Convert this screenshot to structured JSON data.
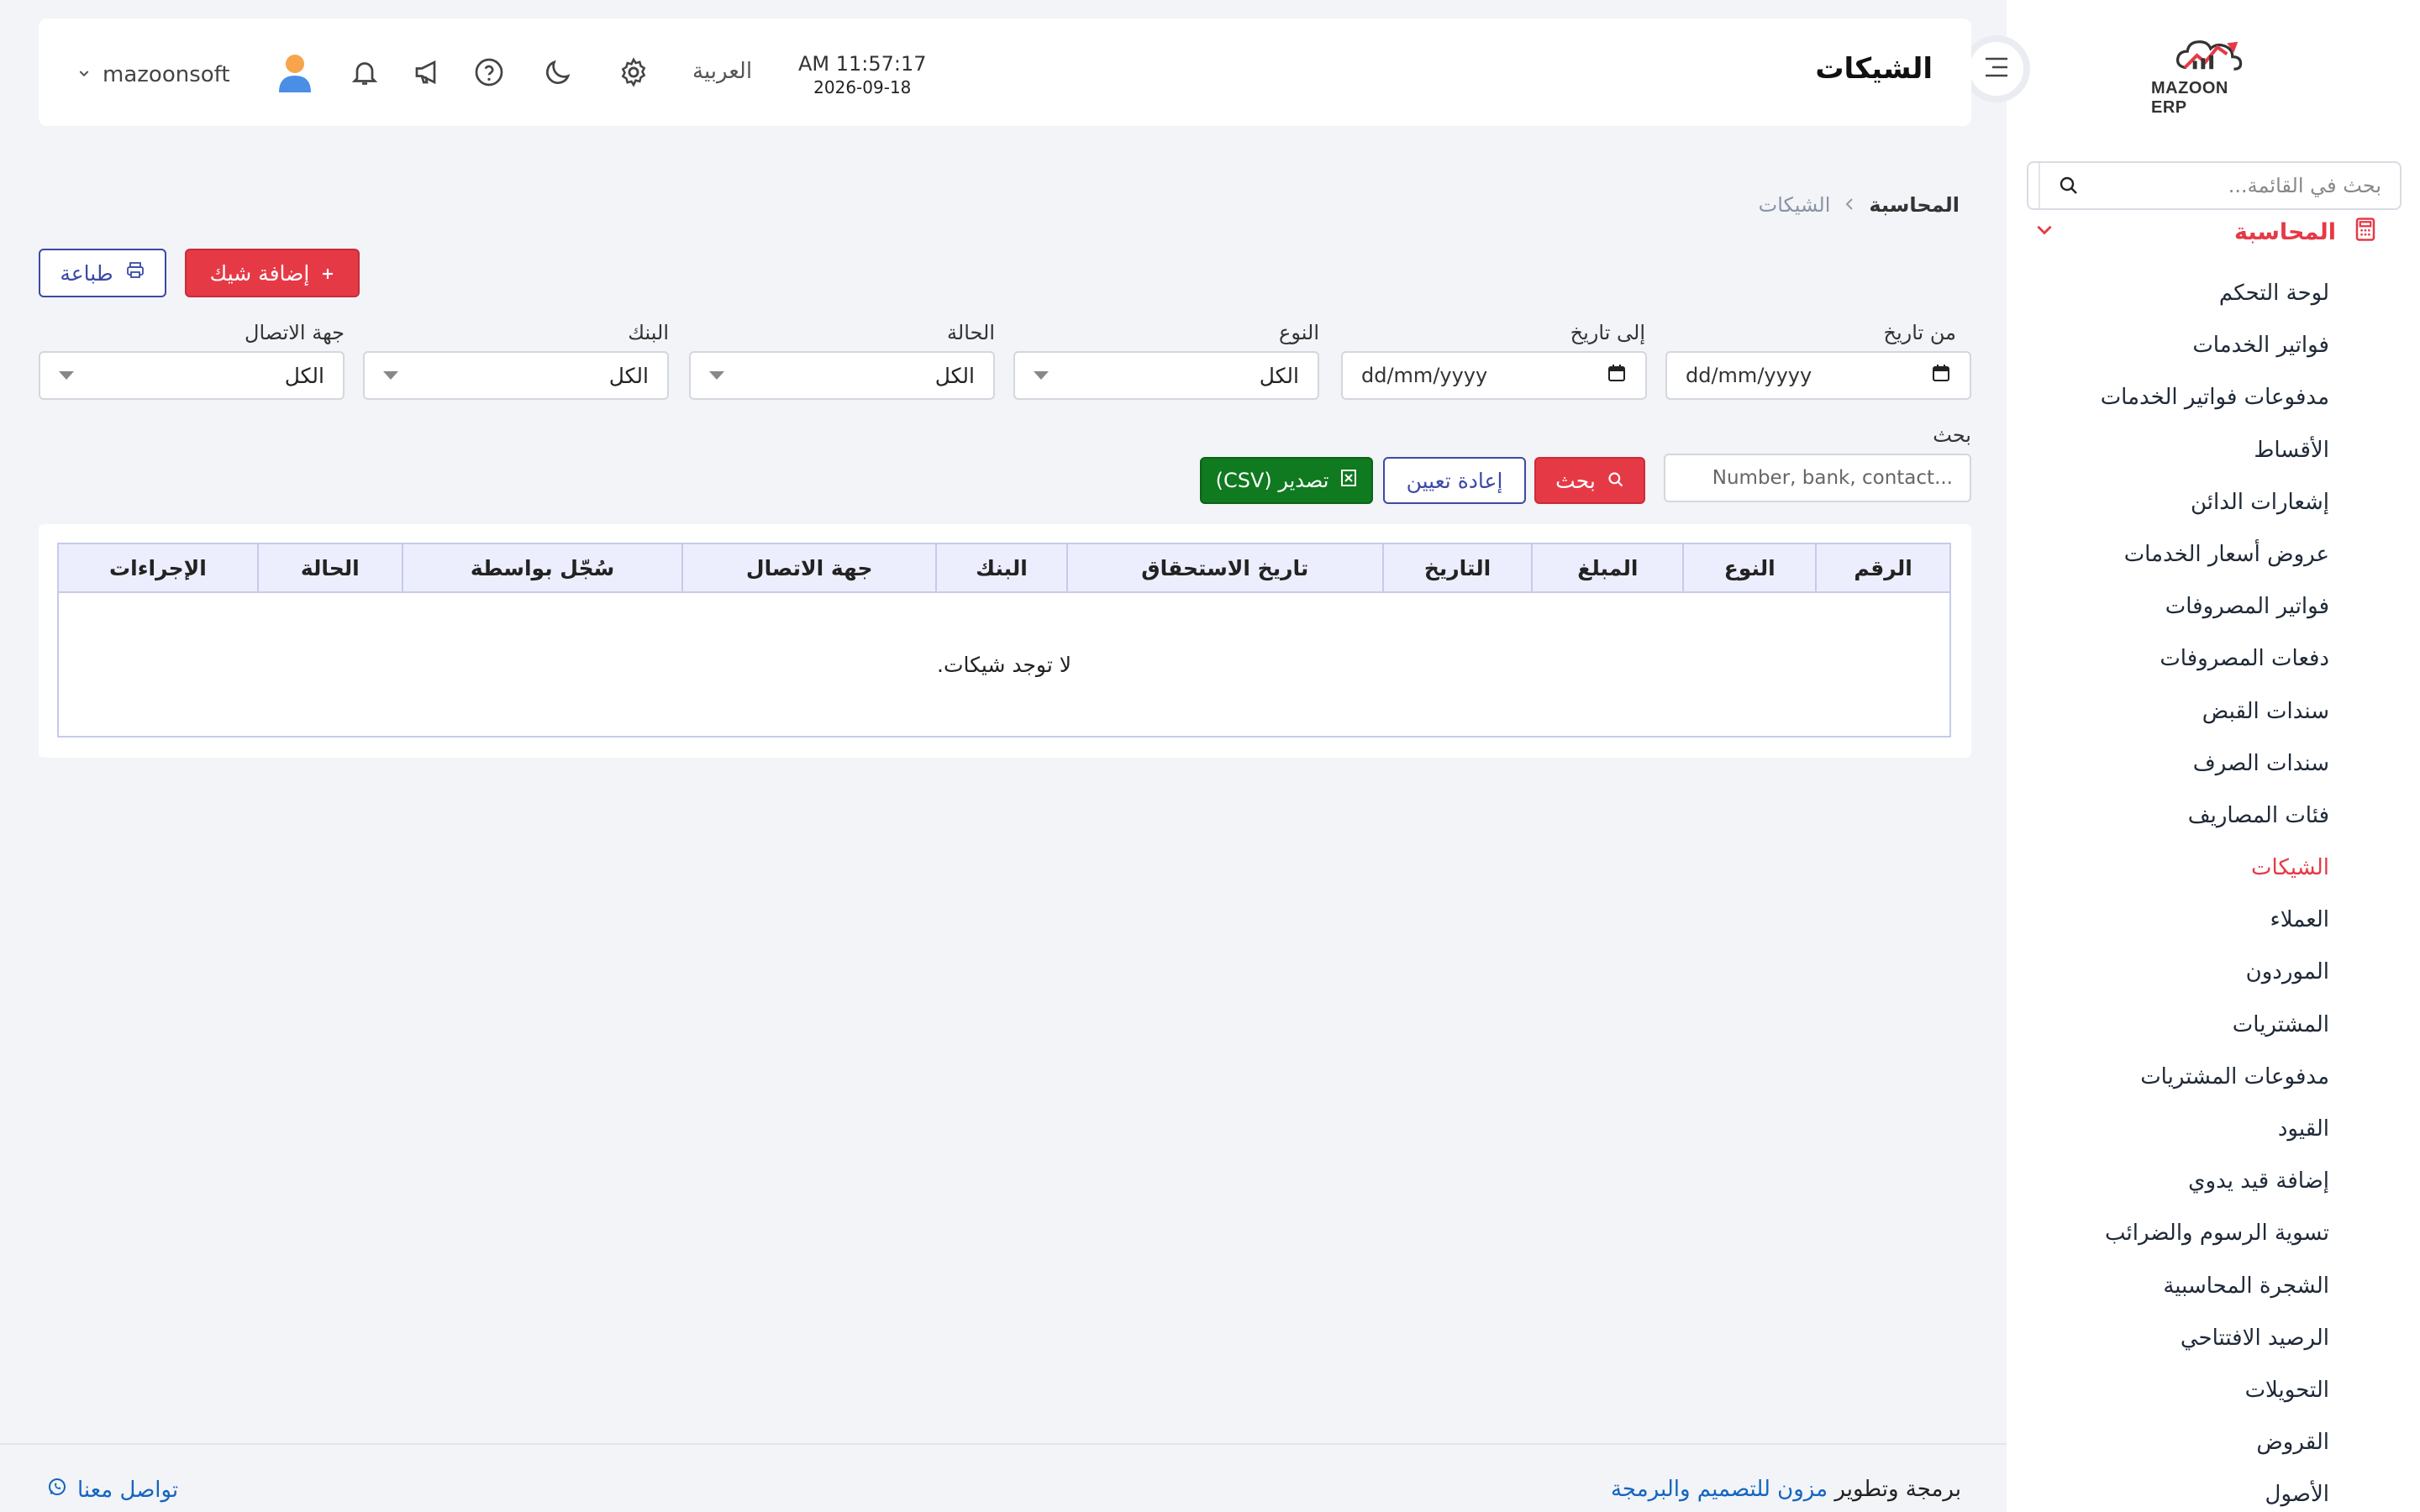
{
  "app": {
    "brand": "MAZOON ERP",
    "accent": "#e63946"
  },
  "sidebar": {
    "search_placeholder": "بحث في القائمة...",
    "group_label": "المحاسبة",
    "items": [
      "لوحة التحكم",
      "فواتير الخدمات",
      "مدفوعات فواتير الخدمات",
      "الأقساط",
      "إشعارات الدائن",
      "عروض أسعار الخدمات",
      "فواتير المصروفات",
      "دفعات المصروفات",
      "سندات القبض",
      "سندات الصرف",
      "فئات المصاريف",
      "الشيكات",
      "العملاء",
      "الموردون",
      "المشتريات",
      "مدفوعات المشتريات",
      "القيود",
      "إضافة قيد يدوي",
      "تسوية الرسوم والضرائب",
      "الشجرة المحاسبية",
      "الرصيد الافتتاحي",
      "التحويلات",
      "القروض",
      "الأصول"
    ],
    "active_item": "الشيكات"
  },
  "header": {
    "title": "الشيكات",
    "time": "AM 11:57:17",
    "date": "2026-09-18",
    "language": "العربية",
    "username": "mazoonsoft"
  },
  "breadcrumb": {
    "parent": "المحاسبة",
    "current": "الشيكات"
  },
  "actions": {
    "add": "إضافة شيك",
    "print": "طباعة"
  },
  "filters": {
    "from_date": {
      "label": "من تاريخ",
      "value": "dd/mm/yyyy"
    },
    "to_date": {
      "label": "إلى تاريخ",
      "value": "dd/mm/yyyy"
    },
    "type": {
      "label": "النوع",
      "value": "الكل"
    },
    "status": {
      "label": "الحالة",
      "value": "الكل"
    },
    "bank": {
      "label": "البنك",
      "value": "الكل"
    },
    "contact": {
      "label": "جهة الاتصال",
      "value": "الكل"
    }
  },
  "search": {
    "label": "بحث",
    "placeholder": "Number, bank, contact...",
    "search_btn": "بحث",
    "reset_btn": "إعادة تعيين",
    "export_btn": "تصدير (CSV)"
  },
  "table": {
    "columns": [
      "الرقم",
      "النوع",
      "المبلغ",
      "التاريخ",
      "تاريخ الاستحقاق",
      "البنك",
      "جهة الاتصال",
      "سُجّل بواسطة",
      "الحالة",
      "الإجراءات"
    ],
    "empty_message": "لا توجد شيكات."
  },
  "footer": {
    "credit_prefix": "برمجة وتطوير",
    "credit_link": "مزون للتصميم والبرمجة",
    "contact": "تواصل معنا"
  }
}
